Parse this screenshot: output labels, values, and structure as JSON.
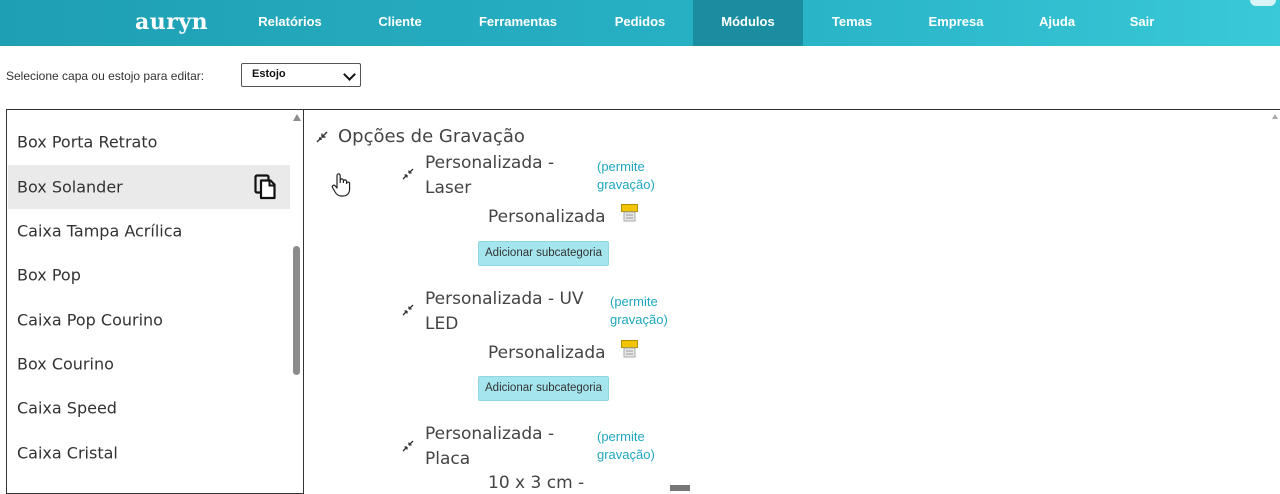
{
  "app": {
    "brand": "auryn"
  },
  "nav": {
    "items": [
      {
        "label": "Relatórios"
      },
      {
        "label": "Cliente"
      },
      {
        "label": "Ferramentas"
      },
      {
        "label": "Pedidos"
      },
      {
        "label": "Módulos",
        "active": true
      },
      {
        "label": "Temas"
      },
      {
        "label": "Empresa"
      },
      {
        "label": "Ajuda"
      },
      {
        "label": "Sair"
      }
    ]
  },
  "selector": {
    "label": "Selecione capa ou estojo para editar:",
    "value": "Estojo"
  },
  "sidebar": {
    "items": [
      {
        "label": "Box Porta Retrato"
      },
      {
        "label": "Box Solander",
        "selected": true,
        "icon": "copy-icon"
      },
      {
        "label": "Caixa Tampa Acrílica"
      },
      {
        "label": "Box Pop"
      },
      {
        "label": "Caixa Pop Courino"
      },
      {
        "label": "Box Courino"
      },
      {
        "label": "Caixa Speed"
      },
      {
        "label": "Caixa Cristal"
      }
    ]
  },
  "main": {
    "section_title": "Opções de Gravação",
    "categories": [
      {
        "name_line1": "Personalizada -",
        "name_line2": "Laser",
        "tag_line1": "(permite",
        "tag_line2": "gravação)",
        "sub": "Personalizada",
        "button": "Adicionar subcategoria"
      },
      {
        "name_line1": "Personalizada - UV",
        "name_line2": "LED",
        "tag_line1": "(permite",
        "tag_line2": "gravação)",
        "sub": "Personalizada",
        "button": "Adicionar subcategoria"
      },
      {
        "name_line1": "Personalizada -",
        "name_line2": "Placa",
        "tag_line1": "(permite",
        "tag_line2": "gravação)",
        "sub": "10 x 3 cm -"
      }
    ]
  },
  "colors": {
    "topbar": "#28b2c6",
    "active_nav": "#1a8ea0",
    "link": "#1fa7c0",
    "button_bg": "#a5e6ee"
  }
}
